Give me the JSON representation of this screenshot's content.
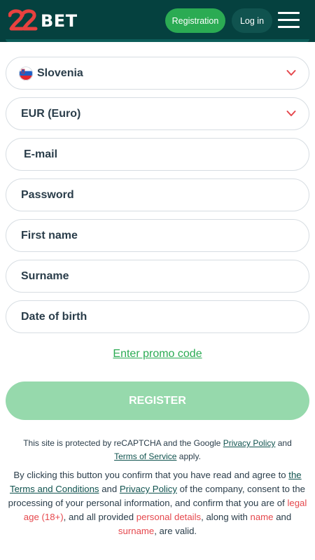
{
  "header": {
    "logo_text": "BET",
    "logo_numerals": "22",
    "registration_label": "Registration",
    "login_label": "Log in",
    "menu_icon": "hamburger-menu-icon"
  },
  "form": {
    "country": {
      "value": "Slovenia",
      "icon": "slovenia-flag-icon"
    },
    "currency": {
      "value": "EUR (Euro)"
    },
    "email": {
      "placeholder": "E-mail"
    },
    "password": {
      "placeholder": "Password"
    },
    "first_name": {
      "placeholder": "First name"
    },
    "surname": {
      "placeholder": "Surname"
    },
    "date_of_birth": {
      "placeholder": "Date of birth"
    },
    "promo_link": "Enter promo code",
    "register_label": "REGISTER"
  },
  "captcha": {
    "prefix": "This site is protected by reCAPTCHA and the Google",
    "privacy_link": "Privacy Policy",
    "and": "and",
    "terms_link": "Terms of Service",
    "suffix": "apply."
  },
  "legal": {
    "p1": "By clicking this button you confirm that you have read and agree to",
    "terms_link": "the Terms and Conditions",
    "p2": "and",
    "privacy_link": "Privacy Policy",
    "p3": "of the company, consent to the processing of your personal information, and confirm that you are of",
    "legal_age": "legal age (18+)",
    "p4": ", and all provided",
    "personal_details": "personal details",
    "p5": ", along with",
    "name": "name",
    "p6": "and",
    "surname": "surname",
    "p7": ", are valid."
  },
  "colors": {
    "header_bg": "#05413f",
    "accent_green": "#2bab53",
    "register_disabled": "#96d9ac",
    "logo_red": "#e8413f",
    "chevron_red": "#e5484d"
  }
}
